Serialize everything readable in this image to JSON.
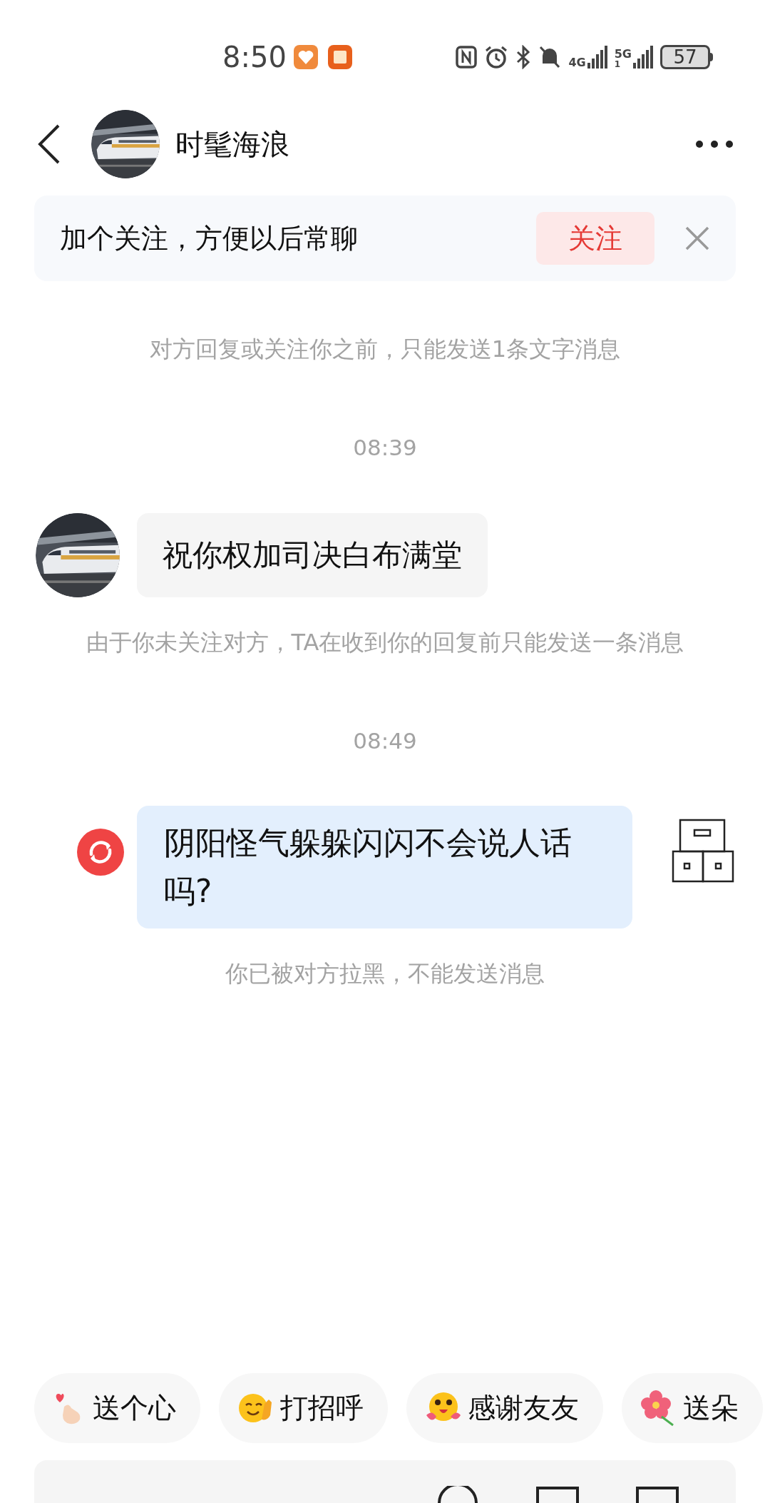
{
  "status_bar": {
    "time": "8:50",
    "networks": [
      {
        "label": "4G"
      },
      {
        "label": "5G",
        "sub": "1"
      }
    ],
    "battery": "57"
  },
  "header": {
    "title": "时髦海浪"
  },
  "follow_banner": {
    "text": "加个关注，方便以后常聊",
    "button": "关注"
  },
  "messages": [
    {
      "kind": "notice",
      "text": "对方回复或关注你之前，只能发送1条文字消息"
    },
    {
      "kind": "time",
      "text": "08:39"
    },
    {
      "kind": "incoming",
      "text": "祝你权加司决白布满堂"
    },
    {
      "kind": "notice",
      "text": "由于你未关注对方，TA在收到你的回复前只能发送一条消息"
    },
    {
      "kind": "time",
      "text": "08:49"
    },
    {
      "kind": "outgoing",
      "text": "阴阳怪气躲躲闪闪不会说人话吗?",
      "failed": true
    },
    {
      "kind": "notice",
      "text": "你已被对方拉黑，不能发送消息"
    }
  ],
  "quick_replies": [
    {
      "kind": "heart",
      "label": "送个心"
    },
    {
      "kind": "wave",
      "label": "打招呼"
    },
    {
      "kind": "hug",
      "label": "感谢友友"
    },
    {
      "kind": "flower",
      "label": "送朵"
    }
  ]
}
